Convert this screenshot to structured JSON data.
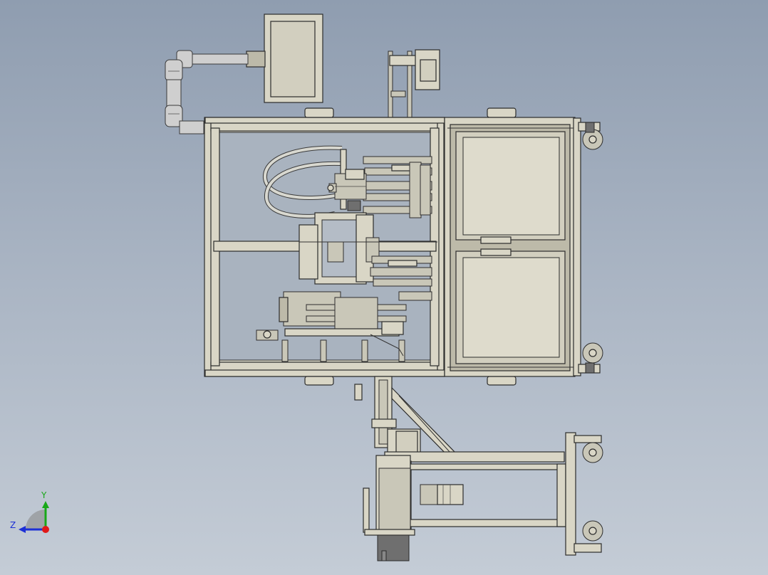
{
  "scene": {
    "type": "cad-assembly-view",
    "background_top": "#8f9db0",
    "background_bottom": "#c4ccd6",
    "part_color": "#d9d6c6",
    "edge_color": "#2c2c2c"
  },
  "triad": {
    "y_label": "Y",
    "z_label": "Z",
    "y_color": "#18a818",
    "z_color": "#1c2fd6",
    "x_color": "#e01818"
  }
}
